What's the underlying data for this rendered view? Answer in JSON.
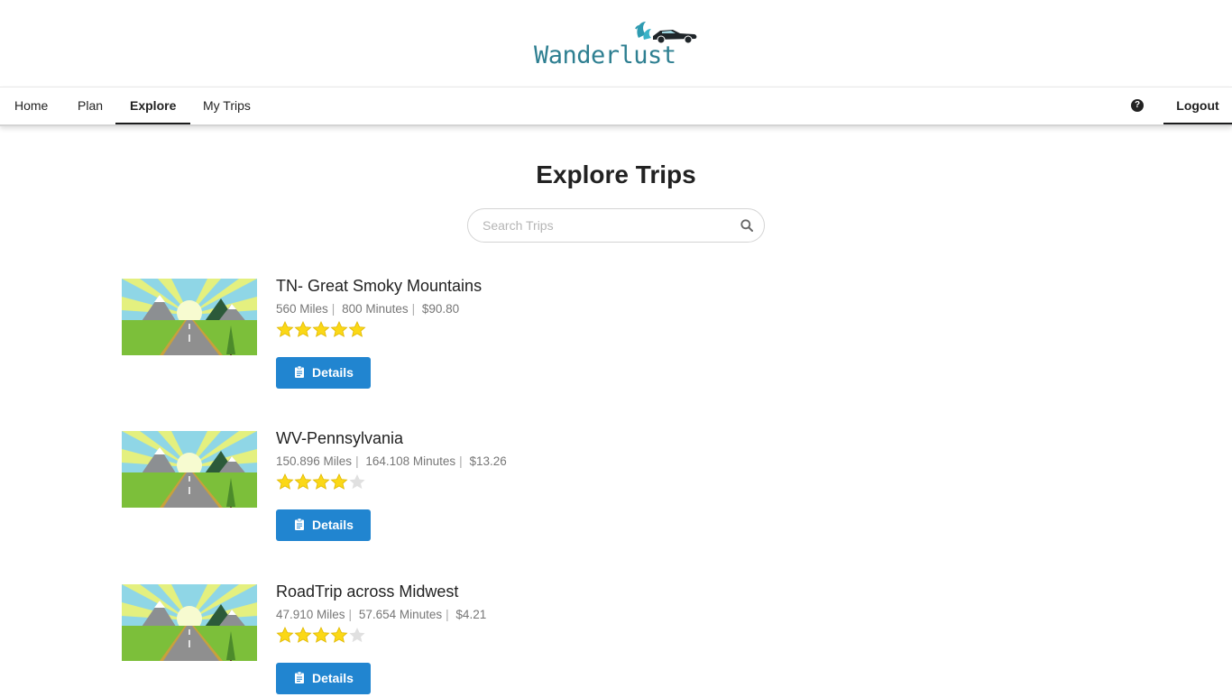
{
  "brand": {
    "name": "Wanderlust"
  },
  "nav": {
    "items": [
      {
        "label": "Home",
        "active": false
      },
      {
        "label": "Plan",
        "active": false
      },
      {
        "label": "Explore",
        "active": true
      },
      {
        "label": "My Trips",
        "active": false
      }
    ],
    "help_icon": "question-circle-icon",
    "logout_label": "Logout"
  },
  "page": {
    "title": "Explore Trips"
  },
  "search": {
    "placeholder": "Search Trips",
    "value": ""
  },
  "trips": [
    {
      "name": "TN- Great Smoky Mountains",
      "miles": "560 Miles",
      "minutes": "800 Minutes",
      "cost": "$90.80",
      "rating": 5,
      "max_rating": 5,
      "button_label": "Details"
    },
    {
      "name": "WV-Pennsylvania",
      "miles": "150.896 Miles",
      "minutes": "164.108 Minutes",
      "cost": "$13.26",
      "rating": 4,
      "max_rating": 5,
      "button_label": "Details"
    },
    {
      "name": "RoadTrip across Midwest",
      "miles": "47.910 Miles",
      "minutes": "57.654 Minutes",
      "cost": "$4.21",
      "rating": 4,
      "max_rating": 5,
      "button_label": "Details"
    }
  ],
  "colors": {
    "accent": "#2185d0",
    "star_on": "#fbd816",
    "star_off": "#e0e0e0",
    "brand": "#2e7f91"
  }
}
